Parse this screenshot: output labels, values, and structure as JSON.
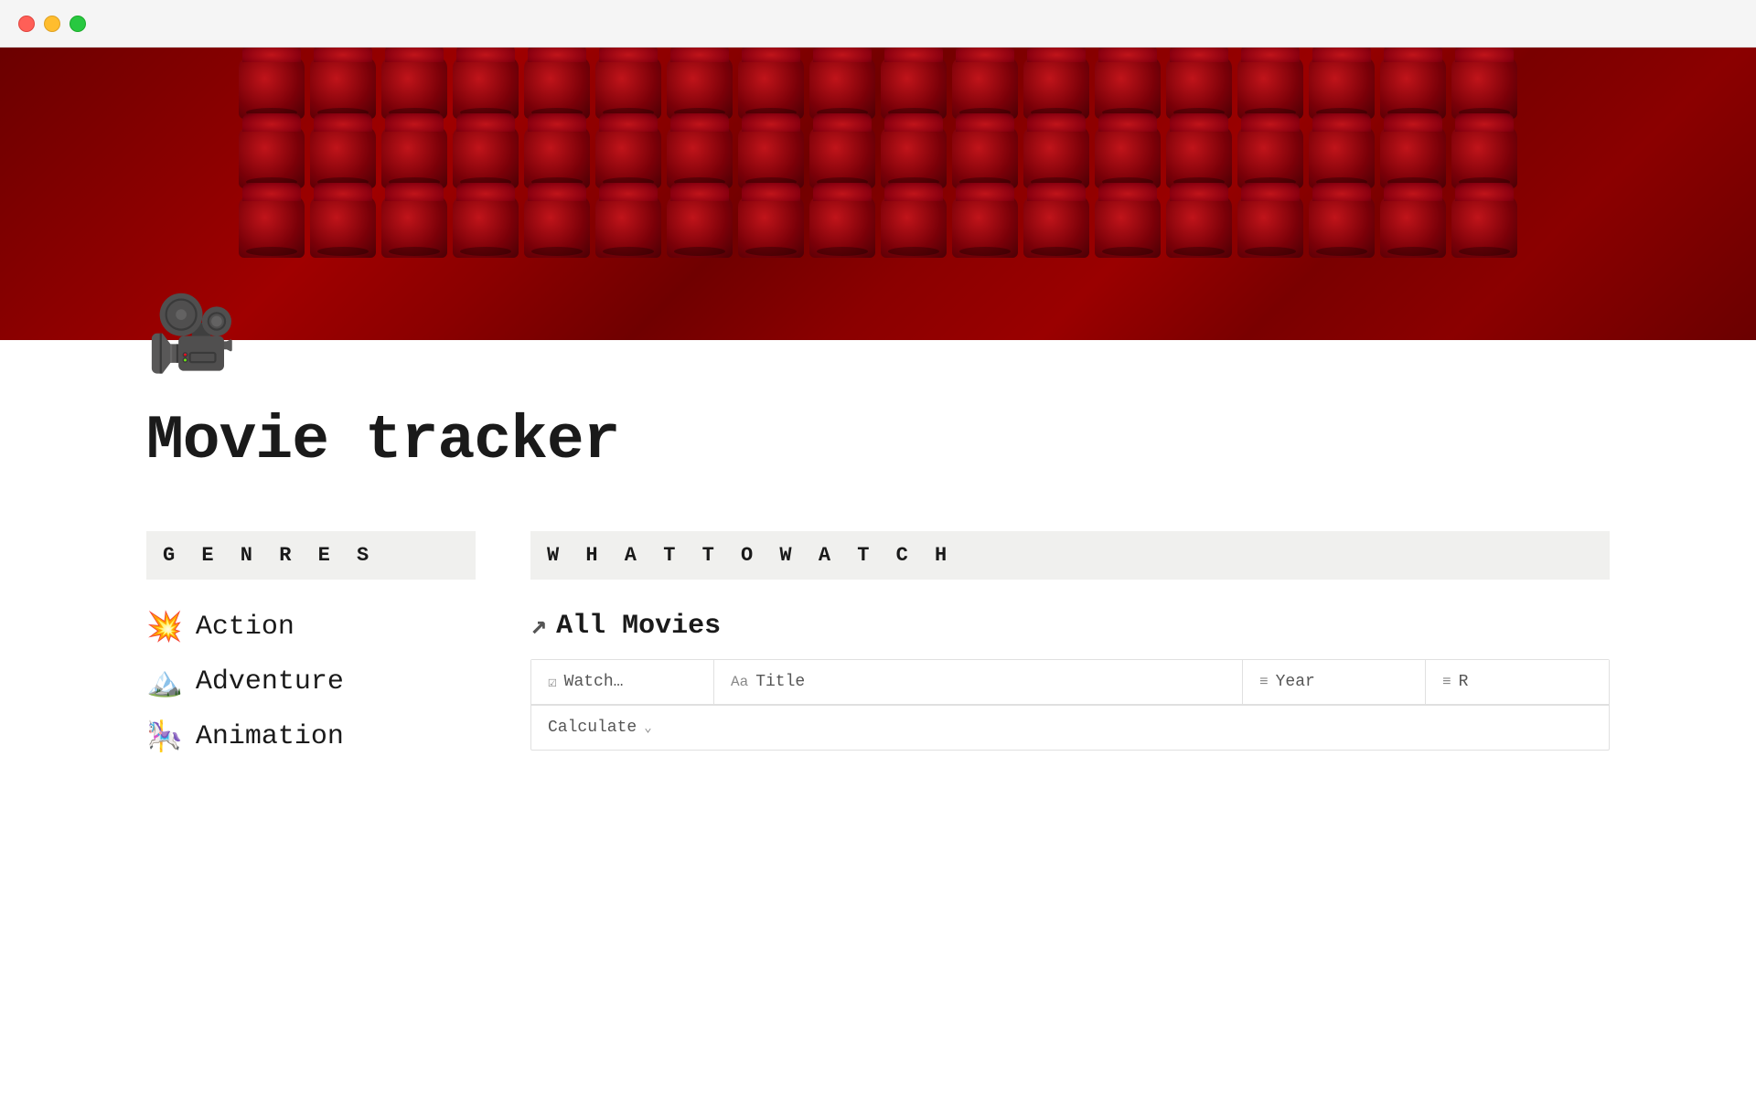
{
  "window": {
    "traffic_lights": {
      "close_label": "close",
      "minimize_label": "minimize",
      "maximize_label": "maximize"
    }
  },
  "page": {
    "icon": "🎥",
    "title": "Movie tracker",
    "sections": {
      "genres": {
        "header": "G E N R E S",
        "items": [
          {
            "emoji": "💥",
            "label": "Action"
          },
          {
            "emoji": "🏔️",
            "label": "Adventure"
          },
          {
            "emoji": "🎠",
            "label": "Animation"
          }
        ]
      },
      "what_to_watch": {
        "header": "W H A T   T O   W A T C H",
        "all_movies": {
          "label": "All Movies",
          "arrow": "↗"
        },
        "table": {
          "headers": [
            {
              "icon": "☑",
              "label": "Watch…"
            },
            {
              "icon": "Aa",
              "label": "Title"
            },
            {
              "icon": "≡",
              "label": "Year"
            },
            {
              "icon": "≡",
              "label": "R"
            }
          ],
          "footer": {
            "label": "Calculate",
            "chevron": "⌄"
          }
        }
      }
    }
  }
}
